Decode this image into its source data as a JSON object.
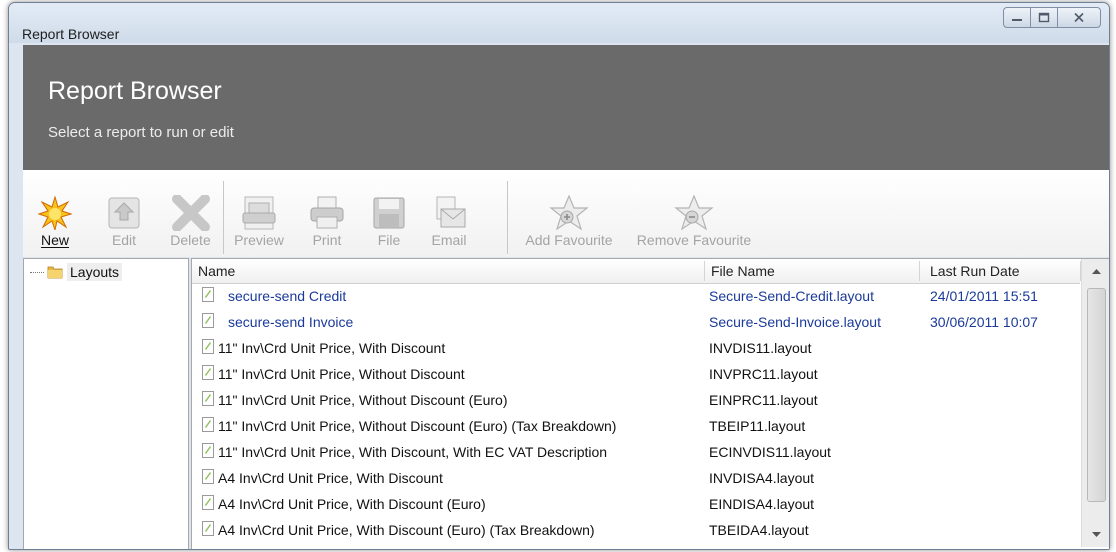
{
  "window": {
    "title": "Report Browser"
  },
  "header": {
    "title": "Report Browser",
    "subtitle": "Select a report to run or edit"
  },
  "toolbar": {
    "new": "New",
    "edit": "Edit",
    "delete": "Delete",
    "preview": "Preview",
    "print": "Print",
    "file": "File",
    "email": "Email",
    "add_favourite": "Add Favourite",
    "remove_favourite": "Remove Favourite"
  },
  "tree": {
    "root": "Layouts"
  },
  "grid": {
    "columns": {
      "name": "Name",
      "file_name": "File Name",
      "last_run_date": "Last Run Date"
    },
    "rows": [
      {
        "name": "secure-send Credit",
        "file": "Secure-Send-Credit.layout",
        "date": "24/01/2011 15:51"
      },
      {
        "name": "secure-send Invoice",
        "file": "Secure-Send-Invoice.layout",
        "date": "30/06/2011 10:07"
      },
      {
        "name": "11\" Inv\\Crd Unit Price, With Discount",
        "file": "INVDIS11.layout",
        "date": ""
      },
      {
        "name": "11\" Inv\\Crd Unit Price, Without Discount",
        "file": "INVPRC11.layout",
        "date": ""
      },
      {
        "name": "11\" Inv\\Crd Unit Price, Without Discount (Euro)",
        "file": "EINPRC11.layout",
        "date": ""
      },
      {
        "name": "11\" Inv\\Crd Unit Price, Without Discount (Euro) (Tax Breakdown)",
        "file": "TBEIP11.layout",
        "date": ""
      },
      {
        "name": "11\" Inv\\Crd Unit Price, With Discount, With EC VAT Description",
        "file": "ECINVDIS11.layout",
        "date": ""
      },
      {
        "name": "A4 Inv\\Crd Unit Price, With Discount",
        "file": "INVDISA4.layout",
        "date": ""
      },
      {
        "name": "A4 Inv\\Crd Unit Price, With Discount (Euro)",
        "file": "EINDISA4.layout",
        "date": ""
      },
      {
        "name": "A4 Inv\\Crd Unit Price, With Discount (Euro) (Tax Breakdown)",
        "file": "TBEIDA4.layout",
        "date": ""
      }
    ]
  },
  "colors": {
    "header_band": "#6a6a6a",
    "favourite_text": "#1a3a9a"
  }
}
